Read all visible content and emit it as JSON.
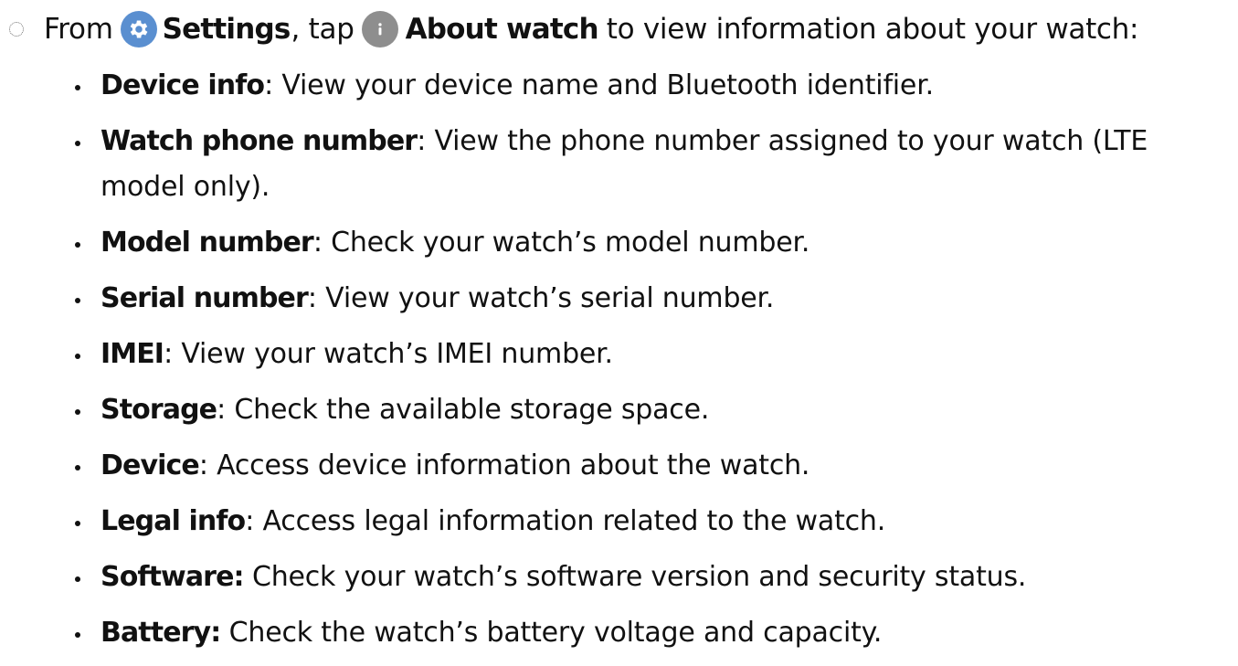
{
  "intro": {
    "from": "From",
    "settings_label": "Settings",
    "tap": ", tap",
    "about_label": "About watch",
    "rest": "to view information about your watch:",
    "settings_icon": "gear-icon",
    "about_icon": "info-icon",
    "settings_icon_color": "#5a8fd0",
    "about_icon_color": "#8e8e8e"
  },
  "items": [
    {
      "term": "Device info",
      "sep": ":",
      "desc": " View your device name and Bluetooth identifier."
    },
    {
      "term": "Watch phone number",
      "sep": ":",
      "desc": " View the phone number assigned to your watch (LTE model only)."
    },
    {
      "term": "Model number",
      "sep": ":",
      "desc": " Check your watch’s model number."
    },
    {
      "term": "Serial number",
      "sep": ":",
      "desc": " View your watch’s serial number."
    },
    {
      "term": "IMEI",
      "sep": ":",
      "desc": " View your watch’s IMEI number."
    },
    {
      "term": "Storage",
      "sep": ":",
      "desc": " Check the available storage space."
    },
    {
      "term": "Device",
      "sep": ":",
      "desc": " Access device information about the watch."
    },
    {
      "term": "Legal info",
      "sep": ":",
      "desc": " Access legal information related to the watch."
    },
    {
      "term": "Software:",
      "sep": "",
      "desc": " Check your watch’s software version and security status."
    },
    {
      "term": "Battery:",
      "sep": "",
      "desc": " Check the watch’s battery voltage and capacity."
    }
  ]
}
